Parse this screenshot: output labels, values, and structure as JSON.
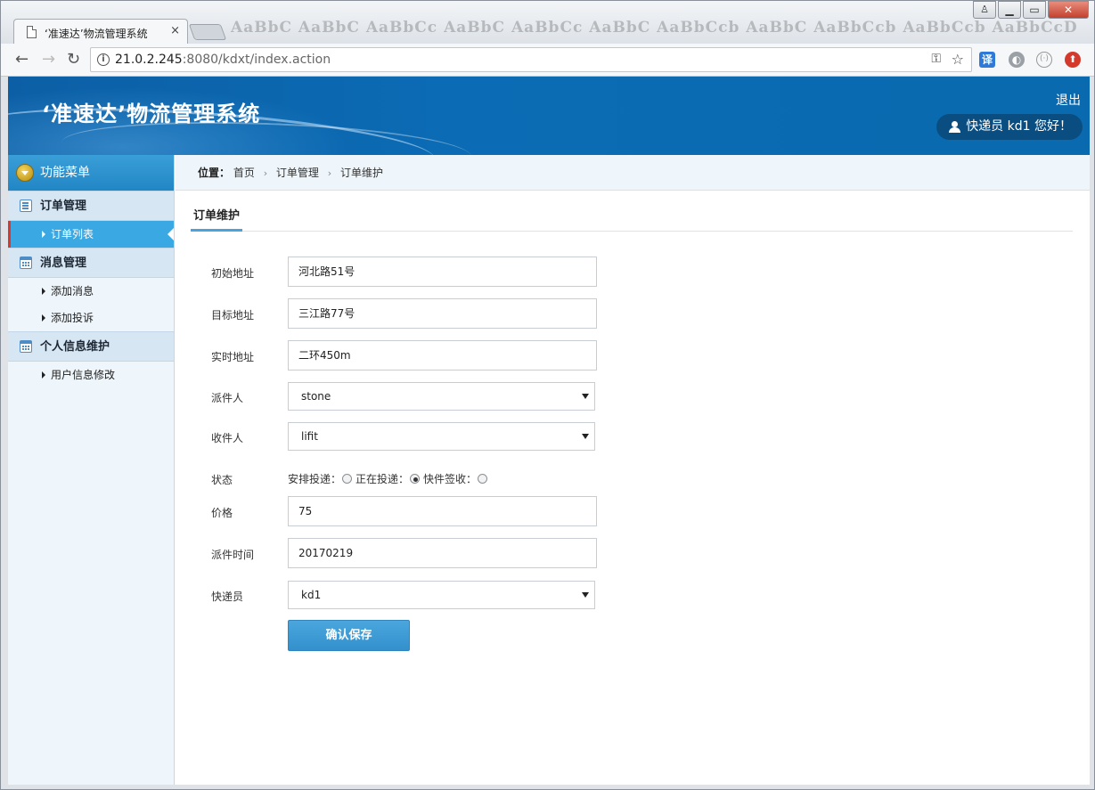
{
  "browser": {
    "tab_title": "‘准速达’物流管理系统",
    "tab_close": "×",
    "ribbon_styles": "AaBbC  AaBbC  AaBbCc  AaBbC  AaBbCc  AaBbC  AaBbCcb  AaBbC  AaBbCcb  AaBbCcb  AaBbCcD",
    "window_buttons": {
      "user": "♙",
      "minimize": "▁",
      "maximize": "▭",
      "close": "✕"
    },
    "url_host": "21.0.2.245",
    "url_rest": ":8080/kdxt/index.action",
    "icons": {
      "back": "←",
      "forward": "→",
      "reload": "↻",
      "info": "i",
      "key": "⚿",
      "star": "☆",
      "translate": "译",
      "globe": "◐",
      "loop": "(·)",
      "upload": "⬆"
    }
  },
  "header": {
    "system_title": "‘准速达’物流管理系统",
    "logout": "退出",
    "user_greeting": "快递员  kd1 您好！"
  },
  "sidebar": {
    "menu_title": "功能菜单",
    "groups": [
      {
        "title": "订单管理",
        "items": [
          "订单列表"
        ]
      },
      {
        "title": "消息管理",
        "items": [
          "添加消息",
          "添加投诉"
        ]
      },
      {
        "title": "个人信息维护",
        "items": [
          "用户信息修改"
        ]
      }
    ]
  },
  "breadcrumb": {
    "label": "位置：",
    "items": [
      "首页",
      "订单管理",
      "订单维护"
    ],
    "separator": "›"
  },
  "section_title": "订单维护",
  "form": {
    "start_address": {
      "label": "初始地址",
      "value": "河北路51号"
    },
    "target_address": {
      "label": "目标地址",
      "value": "三江路77号"
    },
    "current_address": {
      "label": "实时地址",
      "value": "二环450m"
    },
    "sender": {
      "label": "派件人",
      "value": "stone"
    },
    "receiver": {
      "label": "收件人",
      "value": "lifit"
    },
    "status": {
      "label": "状态",
      "options": [
        "安排投递：",
        "正在投递：",
        "快件签收："
      ],
      "selected": "正在投递："
    },
    "price": {
      "label": "价格",
      "value": "75"
    },
    "dispatch_time": {
      "label": "派件时间",
      "value": "20170219"
    },
    "courier": {
      "label": "快递员",
      "value": "kd1"
    },
    "save_label": "确认保存"
  },
  "colors": {
    "header_blue": "#0b6bb4",
    "sidebar_active": "#3aa8e3",
    "button_blue": "#3a9bd6",
    "active_marker": "#d9392c"
  }
}
